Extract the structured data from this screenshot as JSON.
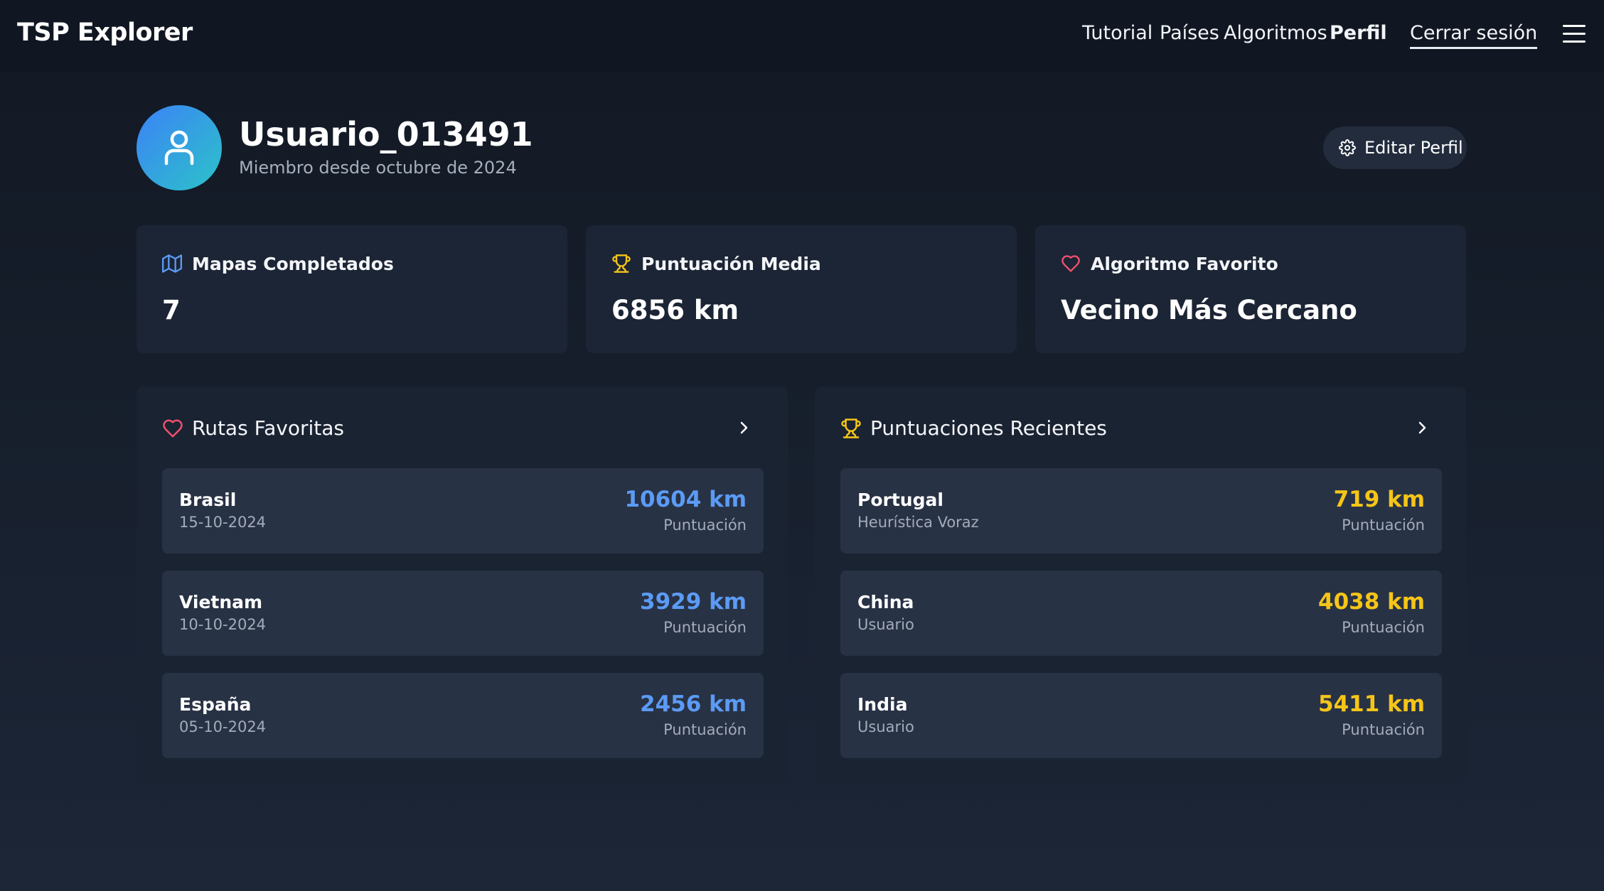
{
  "brand": "TSP Explorer",
  "nav": {
    "tutorial": "Tutorial",
    "countries": "Países",
    "algorithms": "Algoritmos",
    "profile": "Perfil",
    "logout": "Cerrar sesión"
  },
  "profile": {
    "username": "Usuario_013491",
    "member_since": "Miembro desde octubre de 2024",
    "edit_label": "Editar Perfil"
  },
  "stats": [
    {
      "title": "Mapas Completados",
      "value": "7",
      "icon": "map-icon"
    },
    {
      "title": "Puntuación Media",
      "value": "6856 km",
      "icon": "trophy-icon"
    },
    {
      "title": "Algoritmo Favorito",
      "value": "Vecino Más Cercano",
      "icon": "heart-icon"
    }
  ],
  "favorites": {
    "title": "Rutas Favoritas",
    "items": [
      {
        "name": "Brasil",
        "sub": "15-10-2024",
        "value": "10604 km",
        "label": "Puntuación"
      },
      {
        "name": "Vietnam",
        "sub": "10-10-2024",
        "value": "3929 km",
        "label": "Puntuación"
      },
      {
        "name": "España",
        "sub": "05-10-2024",
        "value": "2456 km",
        "label": "Puntuación"
      }
    ]
  },
  "recent": {
    "title": "Puntuaciones Recientes",
    "items": [
      {
        "name": "Portugal",
        "sub": "Heurística Voraz",
        "value": "719 km",
        "label": "Puntuación"
      },
      {
        "name": "China",
        "sub": "Usuario",
        "value": "4038 km",
        "label": "Puntuación"
      },
      {
        "name": "India",
        "sub": "Usuario",
        "value": "5411 km",
        "label": "Puntuación"
      }
    ]
  },
  "colors": {
    "accent_blue": "#5b9bf5",
    "accent_gold": "#f5c518",
    "heart_red": "#f0506e"
  }
}
